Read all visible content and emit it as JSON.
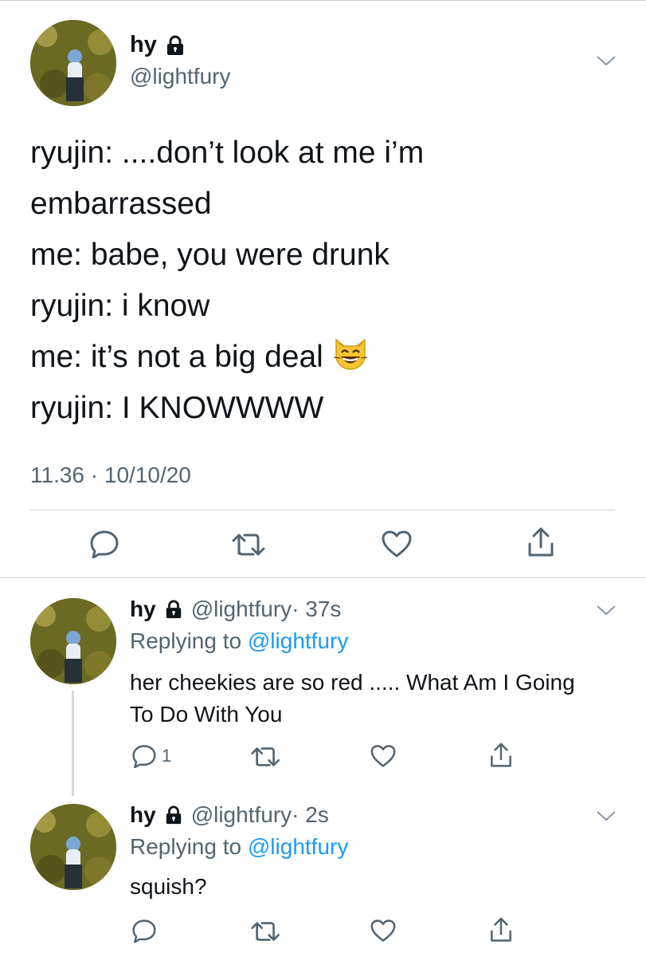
{
  "main_tweet": {
    "display_name": "hy",
    "handle": "@lightfury",
    "lines": [
      "ryujin: ....don’t look at me i’m",
      "embarrassed",
      "me: babe, you were drunk",
      "ryujin: i know",
      "me: it’s not a big deal",
      "ryujin: I KNOWWWW"
    ],
    "emoji": "grinning-cat-with-smiling-eyes",
    "timestamp": "11.36 · 10/10/20",
    "actions": [
      "reply-icon",
      "retweet-icon",
      "like-icon",
      "share-icon"
    ]
  },
  "replies": [
    {
      "display_name": "hy",
      "handle": "@lightfury",
      "time": "· 37s",
      "replying_prefix": "Replying to ",
      "replying_to": "@lightfury",
      "text": "her cheekies are so red ..... What Am I Going To Do With You",
      "reply_count": "1"
    },
    {
      "display_name": "hy",
      "handle": "@lightfury",
      "time": "· 2s",
      "replying_prefix": "Replying to ",
      "replying_to": "@lightfury",
      "text": "squish?",
      "reply_count": ""
    }
  ],
  "colors": {
    "text": "#0f1419",
    "secondary": "#536471",
    "link": "#1d9bf0",
    "divider": "#cfd9de"
  }
}
